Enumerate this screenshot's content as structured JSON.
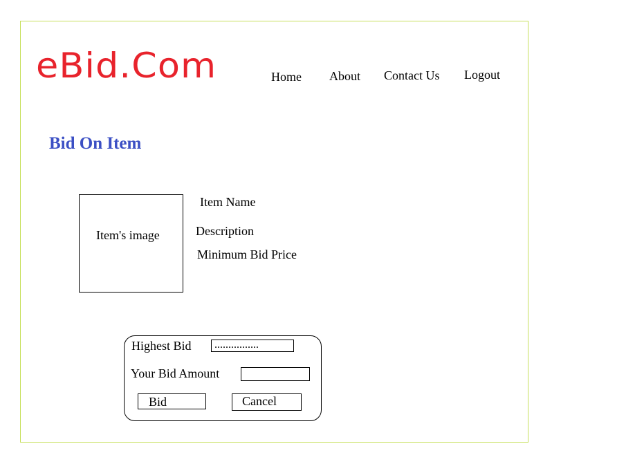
{
  "header": {
    "logo_text": "eBid.Com",
    "logo_color": "#e8232c",
    "nav": {
      "home": "Home",
      "about": "About",
      "contact": "Contact Us",
      "logout": "Logout"
    }
  },
  "main": {
    "title": "Bid On Item",
    "title_color": "#3b4fc4",
    "item": {
      "image_placeholder": "Item's image",
      "name_label": "Item Name",
      "description_label": "Description",
      "min_bid_label": "Minimum Bid Price"
    },
    "bid_form": {
      "highest_bid_label": "Highest Bid",
      "highest_bid_value": "................",
      "your_bid_label": "Your Bid Amount",
      "your_bid_value": "",
      "bid_button": "Bid",
      "cancel_button": "Cancel"
    }
  },
  "frame_border_color": "#c6e05a"
}
